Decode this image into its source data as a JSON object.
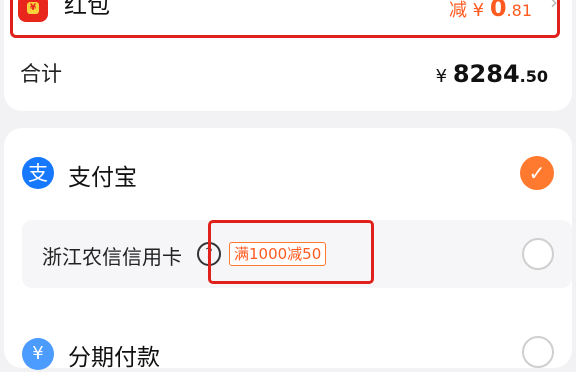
{
  "red_packet": {
    "label": "红包",
    "icon": "red-packet-icon",
    "discount_prefix": "减 ¥ ",
    "discount_int": "0",
    "discount_dec": ".81"
  },
  "total": {
    "label": "合计",
    "currency": "¥ ",
    "int": "8284",
    "dec": ".50"
  },
  "alipay": {
    "label": "支付宝",
    "icon_glyph": "支",
    "check_glyph": "✓"
  },
  "credit_card": {
    "label": "浙江农信信用卡",
    "help_glyph": "?",
    "promo": "满1000减50"
  },
  "installment": {
    "label": "分期付款",
    "icon_glyph": "¥"
  },
  "colors": {
    "accent": "#ff7a2e",
    "highlight_red": "#e0201a",
    "alipay_blue": "#1677ff"
  }
}
